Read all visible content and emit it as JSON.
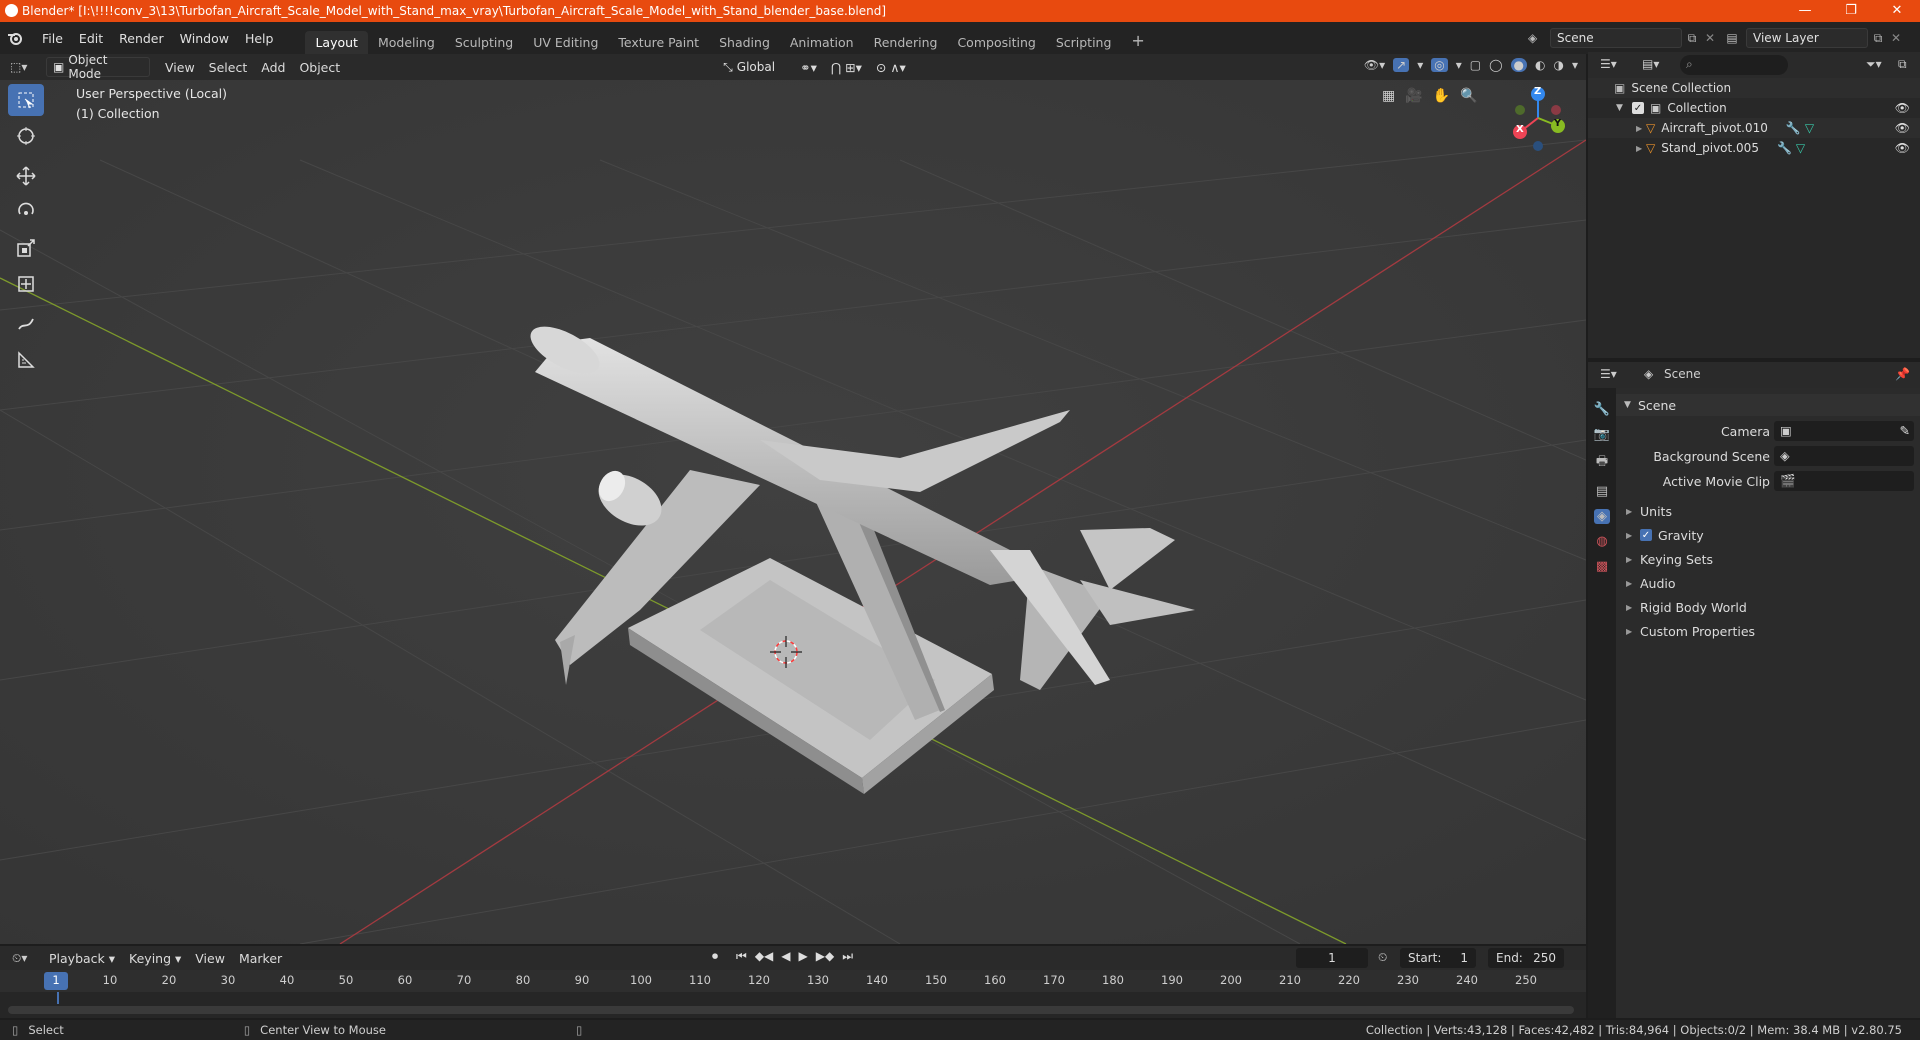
{
  "window": {
    "title": "Blender* [I:\\!!!!conv_3\\13\\Turbofan_Aircraft_Scale_Model_with_Stand_max_vray\\Turbofan_Aircraft_Scale_Model_with_Stand_blender_base.blend]",
    "minimize": "—",
    "maximize": "❐",
    "close": "✕"
  },
  "menu": {
    "file": "File",
    "edit": "Edit",
    "render": "Render",
    "window": "Window",
    "help": "Help"
  },
  "workspaces": [
    "Layout",
    "Modeling",
    "Sculpting",
    "UV Editing",
    "Texture Paint",
    "Shading",
    "Animation",
    "Rendering",
    "Compositing",
    "Scripting"
  ],
  "workspace_add": "+",
  "scene_name": "Scene",
  "view_layer": "View Layer",
  "viewport": {
    "mode": "Object Mode",
    "menus": [
      "View",
      "Select",
      "Add",
      "Object"
    ],
    "orientation": "Global",
    "info_line1": "User Perspective (Local)",
    "info_line2": "(1) Collection",
    "gizmo": {
      "z": "Z",
      "y": "Y",
      "x": "X"
    }
  },
  "outliner": {
    "root": "Scene Collection",
    "collection": "Collection",
    "objects": [
      "Aircraft_pivot.010",
      "Stand_pivot.005"
    ]
  },
  "properties": {
    "header": "Scene",
    "panel": "Scene",
    "camera_label": "Camera",
    "bg_scene_label": "Background Scene",
    "movie_clip_label": "Active Movie Clip",
    "sections": [
      "Units",
      "Gravity",
      "Keying Sets",
      "Audio",
      "Rigid Body World",
      "Custom Properties"
    ]
  },
  "timeline": {
    "menus": [
      "Playback",
      "Keying",
      "View",
      "Marker"
    ],
    "current_frame": "1",
    "start_label": "Start:",
    "start": "1",
    "end_label": "End:",
    "end": "250",
    "ruler_marks": [
      "1",
      "10",
      "20",
      "30",
      "40",
      "50",
      "60",
      "70",
      "80",
      "90",
      "100",
      "110",
      "120",
      "130",
      "140",
      "150",
      "160",
      "170",
      "180",
      "190",
      "200",
      "210",
      "220",
      "230",
      "240",
      "250"
    ]
  },
  "status": {
    "left_action": "Select",
    "mid_action": "Center View to Mouse",
    "stats": "Collection | Verts:43,128 | Faces:42,482 | Tris:84,964 | Objects:0/2 | Mem: 38.4 MB | v2.80.75"
  },
  "colors": {
    "accent": "#4772b3",
    "titlebar": "#e84a0f",
    "x_axis": "#ee4455",
    "y_axis": "#88bb22",
    "z_axis": "#3388ee"
  }
}
